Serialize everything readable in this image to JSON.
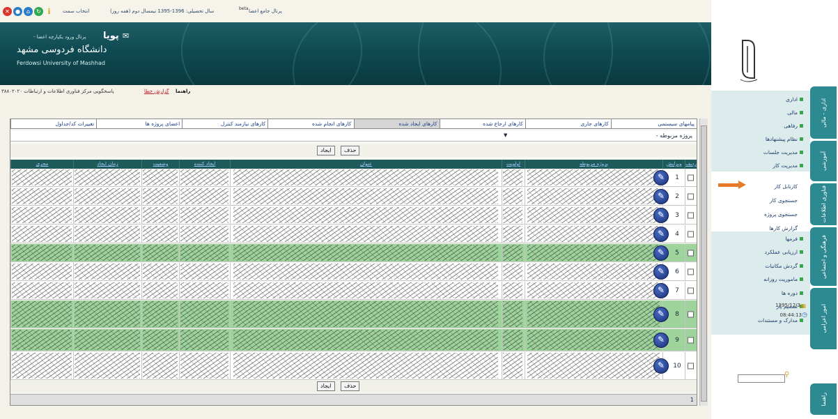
{
  "topbar": {
    "icons": [
      {
        "name": "close-icon",
        "color": "#d9362b"
      },
      {
        "name": "user-icon",
        "color": "#2a7ec9"
      },
      {
        "name": "home-icon",
        "color": "#2a7ec9"
      },
      {
        "name": "refresh-icon",
        "color": "#2fa84f"
      },
      {
        "name": "help-icon",
        "color": "#d8a416"
      }
    ],
    "select_semester": "انتخاب سمت",
    "year_info": "سال تحصیلی: 1396-1395 نیمسال دوم (همه روز)",
    "portal_title": "پرتال جامع اعضا",
    "beta_label": "beta"
  },
  "banner": {
    "app_name": "پویا",
    "nav_links": "- پرتال ورود یکپارچه اعضا",
    "university_fa": "دانشگاه فردوسی مشهد",
    "university_en": "Ferdowsi University of Mashhad"
  },
  "helpline": {
    "guide": "راهنما",
    "report_bug": "گزارش خطا",
    "support": "پاسخگویی مرکز فناوری اطلاعات و ارتباطات ۳۸۸۰۲۰۲۰"
  },
  "tabs": [
    "پیامهای سیستمی",
    "کارهای جاری",
    "کارهای ارجاع شده",
    "کارهای ایجاد شده",
    "کارهای انجام شده",
    "کارهای نیازمند کنترل",
    "اعضای پروژه ها",
    "تغییرات کد/جداول"
  ],
  "active_tab_index": 3,
  "project_select": {
    "value": "پروژه مربوطه -"
  },
  "buttons": {
    "delete": "حذف",
    "create": "ایجاد"
  },
  "table": {
    "columns": [
      "ردیف",
      "ویرایش",
      "پروژه مربوطه",
      "اولویت",
      "عنوان",
      "ایجاد کننده",
      "وضعیت",
      "زمان ایجاد",
      "مجری"
    ],
    "rows": [
      {
        "n": "1",
        "highlight": false
      },
      {
        "n": "2",
        "highlight": false
      },
      {
        "n": "3",
        "highlight": false
      },
      {
        "n": "4",
        "highlight": false
      },
      {
        "n": "5",
        "highlight": true
      },
      {
        "n": "6",
        "highlight": false
      },
      {
        "n": "7",
        "highlight": false
      },
      {
        "n": "8",
        "highlight": true
      },
      {
        "n": "9",
        "highlight": true
      },
      {
        "n": "10",
        "highlight": false
      }
    ]
  },
  "footer": {
    "page": "1"
  },
  "sidebar": {
    "vertical_tabs": [
      "اداری - مالی",
      "آموزشی",
      "فناوری اطلاعات",
      "فرهنگی و اجتماعی",
      "امور اعزامی",
      "راهنما"
    ],
    "group1": [
      "اداری",
      "مالی",
      "رفاهی",
      "نظام پیشنهادها",
      "مدیریت جلسات",
      "مدیریت کار"
    ],
    "work_sub": [
      "کارتابل کار",
      "جستجوی کار",
      "جستجوی پروژه",
      "گزارش کارها"
    ],
    "group2": [
      "فرمها",
      "ارزیابی عملکرد",
      "گردش مکاتبات",
      "ماموریت روزانه",
      "دوره ها",
      "تصمیم یار",
      "مدارک و مستندات"
    ],
    "date": "1395/12/3",
    "time": "08:44:13"
  }
}
